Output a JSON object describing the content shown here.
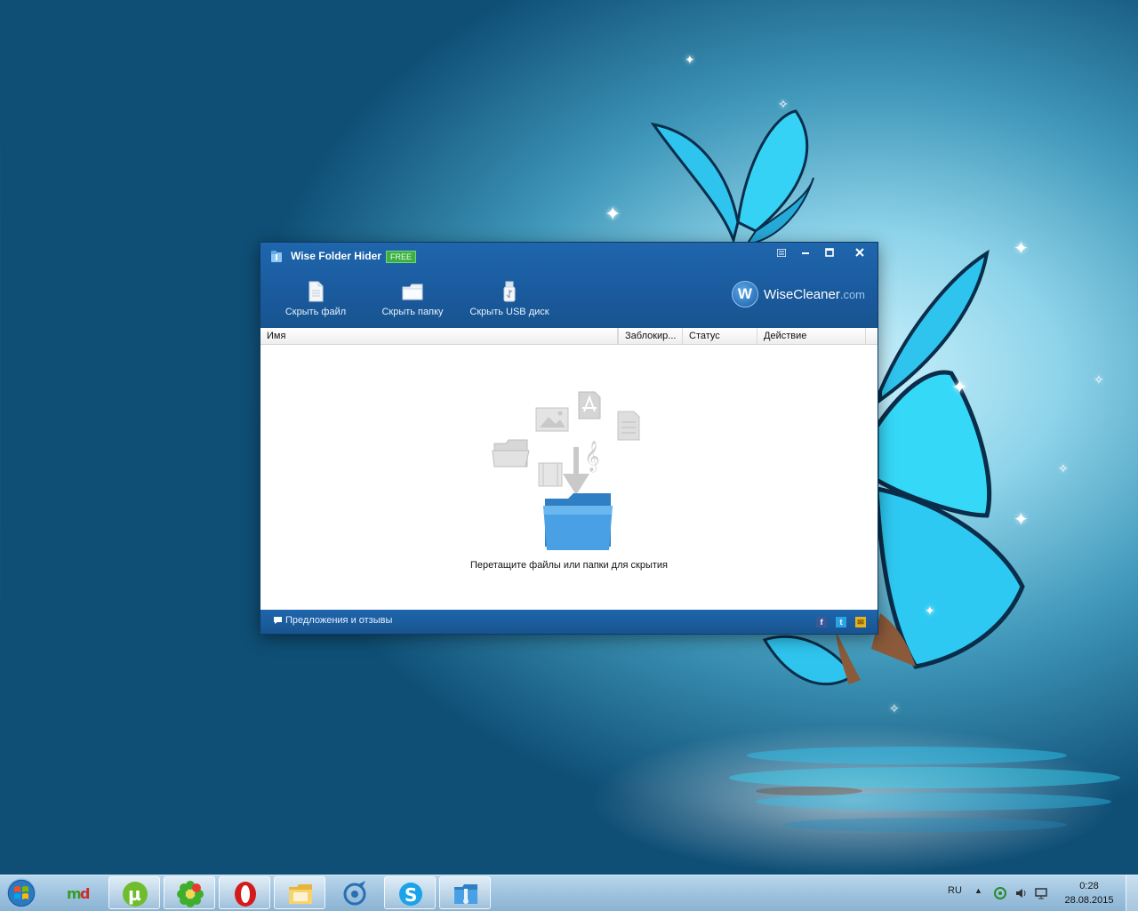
{
  "window": {
    "title": "Wise Folder Hider",
    "badge": "FREE",
    "toolbar": {
      "hide_file": "Скрыть файл",
      "hide_folder": "Скрыть папку",
      "hide_usb": "Скрыть USB диск"
    },
    "brand": {
      "name": "WiseCleaner",
      "domain": ".com",
      "logo_letter": "W"
    },
    "columns": {
      "name": "Имя",
      "locked": "Заблокир...",
      "status": "Статус",
      "action": "Действие"
    },
    "empty_hint": "Перетащите файлы или папки для скрытия",
    "feedback": "Предложения и отзывы",
    "social": [
      "facebook-icon",
      "twitter-icon",
      "email-icon"
    ]
  },
  "taskbar": {
    "apps": [
      "mydealer-icon",
      "utorrent-icon",
      "icq-icon",
      "opera-icon",
      "file-manager-icon",
      "aimp-icon",
      "skype-icon",
      "wise-folder-hider-icon"
    ],
    "language": "RU",
    "time": "0:28",
    "date": "28.08.2015"
  },
  "colors": {
    "window_blue": "#1a5a9d",
    "free_badge": "#3cb043",
    "folder_blue": "#3a8fd6"
  }
}
